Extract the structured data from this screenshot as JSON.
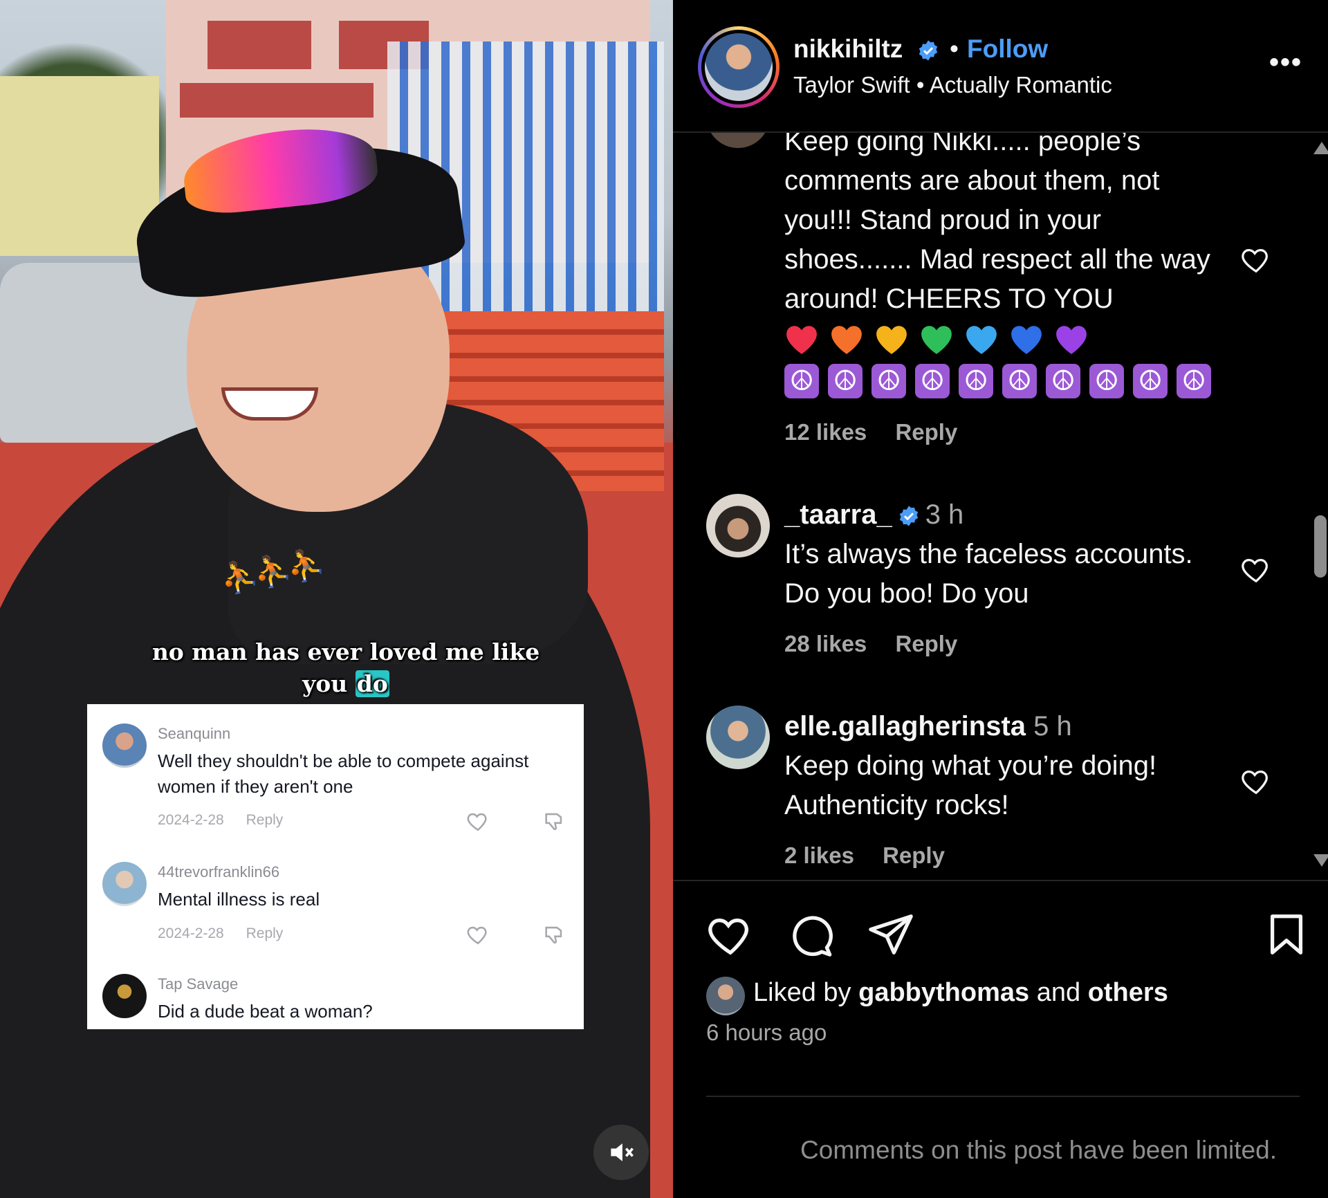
{
  "video": {
    "caption_line1": "no man has ever loved me like",
    "caption_word1": "you",
    "caption_highlight": "do",
    "mute_icon": "speaker-muted-icon",
    "overlay_comments": [
      {
        "username": "Seanquinn",
        "text": "Well they shouldn't be able to compete against women if they aren't one",
        "date": "2024-2-28",
        "reply_label": "Reply"
      },
      {
        "username": "44trevorfranklin66",
        "text": "Mental illness is real",
        "date": "2024-2-28",
        "reply_label": "Reply"
      },
      {
        "username": "Tap Savage",
        "text": "Did a dude beat a woman?"
      }
    ]
  },
  "post": {
    "header": {
      "username": "nikkihiltz",
      "separator": "•",
      "follow_label": "Follow",
      "audio": "Taylor Swift • Actually Romantic",
      "more_icon": "more-options-icon"
    },
    "comments": [
      {
        "text": "Keep going Nikki..... people’s comments are about them, not you!!! Stand proud in your shoes....... Mad respect all the way around! CHEERS TO YOU",
        "hearts": [
          "#f0314b",
          "#f5702a",
          "#f6b21a",
          "#2fbf5a",
          "#3aa7ee",
          "#2f6fe8",
          "#9b42e6"
        ],
        "peace_count_glyph": "☮",
        "likes": "12 likes",
        "reply_label": "Reply"
      },
      {
        "username": "_taarra_",
        "time": "3 h",
        "text": "It’s always the faceless accounts. Do you boo! Do you",
        "likes": "28 likes",
        "reply_label": "Reply"
      },
      {
        "username": "elle.gallagherinsta",
        "time": "5 h",
        "text": "Keep doing what you’re doing! Authenticity rocks!",
        "likes": "2 likes",
        "reply_label": "Reply"
      }
    ],
    "actions": {
      "liked_prefix": "Liked by",
      "liked_user": "gabbythomas",
      "liked_and": "and",
      "liked_others": "others",
      "time_ago": "6 hours ago",
      "limited_notice": "Comments on this post have been limited."
    },
    "colors": {
      "follow": "#4c9df8",
      "verified": "#4c9df8",
      "muted_text": "#a8a8a8"
    }
  }
}
